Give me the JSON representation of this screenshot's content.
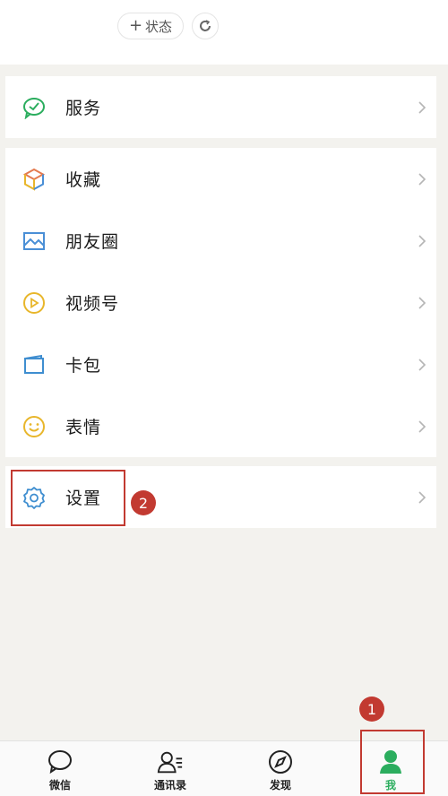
{
  "top": {
    "status_plus": "+",
    "status_label": "状态"
  },
  "groups": {
    "service": {
      "label": "服务"
    },
    "main": [
      {
        "label": "收藏"
      },
      {
        "label": "朋友圈"
      },
      {
        "label": "视频号"
      },
      {
        "label": "卡包"
      },
      {
        "label": "表情"
      }
    ],
    "settings": {
      "label": "设置"
    }
  },
  "tabbar": [
    {
      "label": "微信"
    },
    {
      "label": "通讯录"
    },
    {
      "label": "发现"
    },
    {
      "label": "我"
    }
  ],
  "annotations": {
    "badge_1": "1",
    "badge_2": "2"
  },
  "colors": {
    "accent": "#2bad5e",
    "annotation": "#c23a31"
  }
}
